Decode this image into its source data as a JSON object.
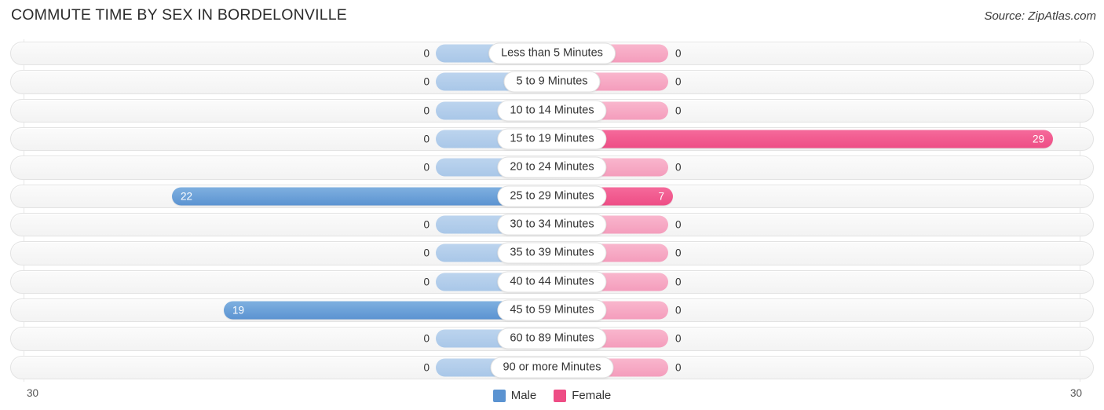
{
  "header": {
    "title": "COMMUTE TIME BY SEX IN BORDELONVILLE",
    "source": "Source: ZipAtlas.com"
  },
  "legend": {
    "items": [
      {
        "label": "Male",
        "color": "#5b93d1"
      },
      {
        "label": "Female",
        "color": "#ee4d85"
      }
    ]
  },
  "axis": {
    "left_label": "30",
    "right_label": "30"
  },
  "chart_data": {
    "type": "bar",
    "orientation": "horizontal",
    "style": "diverging-bidirectional",
    "title": "COMMUTE TIME BY SEX IN BORDELONVILLE",
    "xlabel": "",
    "ylabel": "",
    "axis_max": 30,
    "xlim": [
      30,
      30
    ],
    "grid": true,
    "legend_position": "bottom-center",
    "categories": [
      "Less than 5 Minutes",
      "5 to 9 Minutes",
      "10 to 14 Minutes",
      "15 to 19 Minutes",
      "20 to 24 Minutes",
      "25 to 29 Minutes",
      "30 to 34 Minutes",
      "35 to 39 Minutes",
      "40 to 44 Minutes",
      "45 to 59 Minutes",
      "60 to 89 Minutes",
      "90 or more Minutes"
    ],
    "series": [
      {
        "name": "Male",
        "color": "#5b93d1",
        "side": "left",
        "values": [
          0,
          0,
          0,
          0,
          0,
          22,
          0,
          0,
          0,
          19,
          0,
          0
        ]
      },
      {
        "name": "Female",
        "color": "#ee4d85",
        "side": "right",
        "values": [
          0,
          0,
          0,
          29,
          0,
          7,
          0,
          0,
          0,
          0,
          0,
          0
        ]
      }
    ]
  }
}
